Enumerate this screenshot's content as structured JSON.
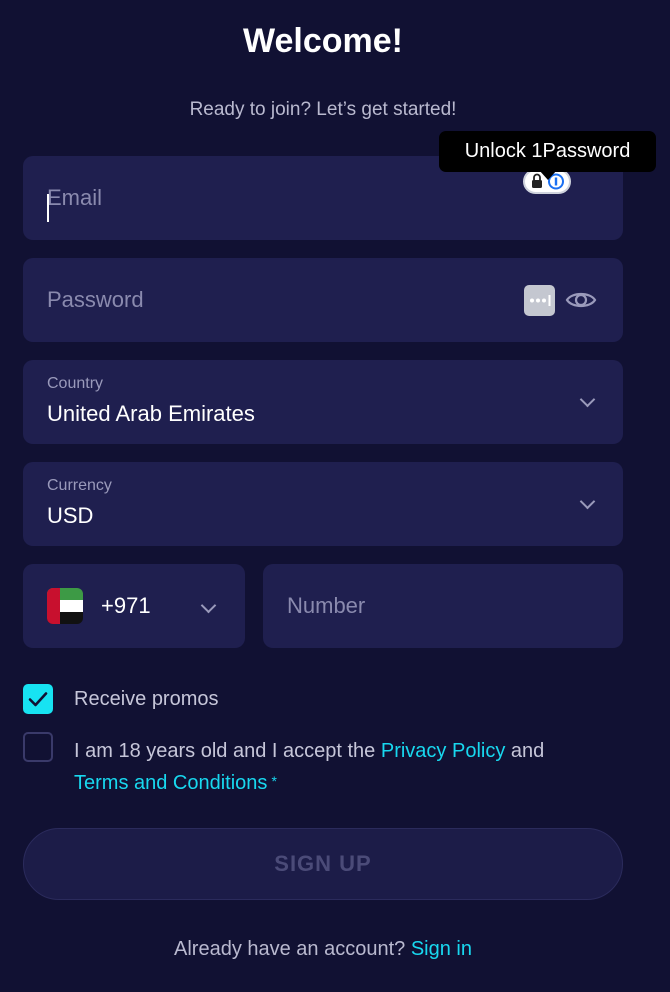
{
  "header": {
    "title": "Welcome!",
    "subtitle": "Ready to join? Let’s get started!"
  },
  "email": {
    "placeholder": "Email"
  },
  "onepassword": {
    "tooltip": "Unlock 1Password",
    "lock_icon": "lock-icon",
    "logo_icon": "onepassword-icon"
  },
  "password": {
    "placeholder": "Password",
    "key_icon": "password-manager-icon",
    "toggle_icon": "eye-icon"
  },
  "country": {
    "label": "Country",
    "value": "United Arab Emirates"
  },
  "currency": {
    "label": "Currency",
    "value": "USD"
  },
  "phone": {
    "code": "+971",
    "flag": "uae-flag-icon",
    "placeholder": "Number"
  },
  "promos": {
    "label": "Receive promos",
    "checked": true
  },
  "terms": {
    "prefix": "I am 18 years old and I accept the ",
    "privacy_link": "Privacy Policy",
    "and": " and",
    "terms_link": "Terms and Conditions",
    "required_mark": "*",
    "checked": false
  },
  "signup_button": "SIGN UP",
  "footer": {
    "text": "Already have an account? ",
    "link": "Sign in"
  },
  "colors": {
    "background": "#111133",
    "field": "#1f1f4f",
    "accent": "#17e3f2",
    "muted_text": "#b9b9cf"
  }
}
